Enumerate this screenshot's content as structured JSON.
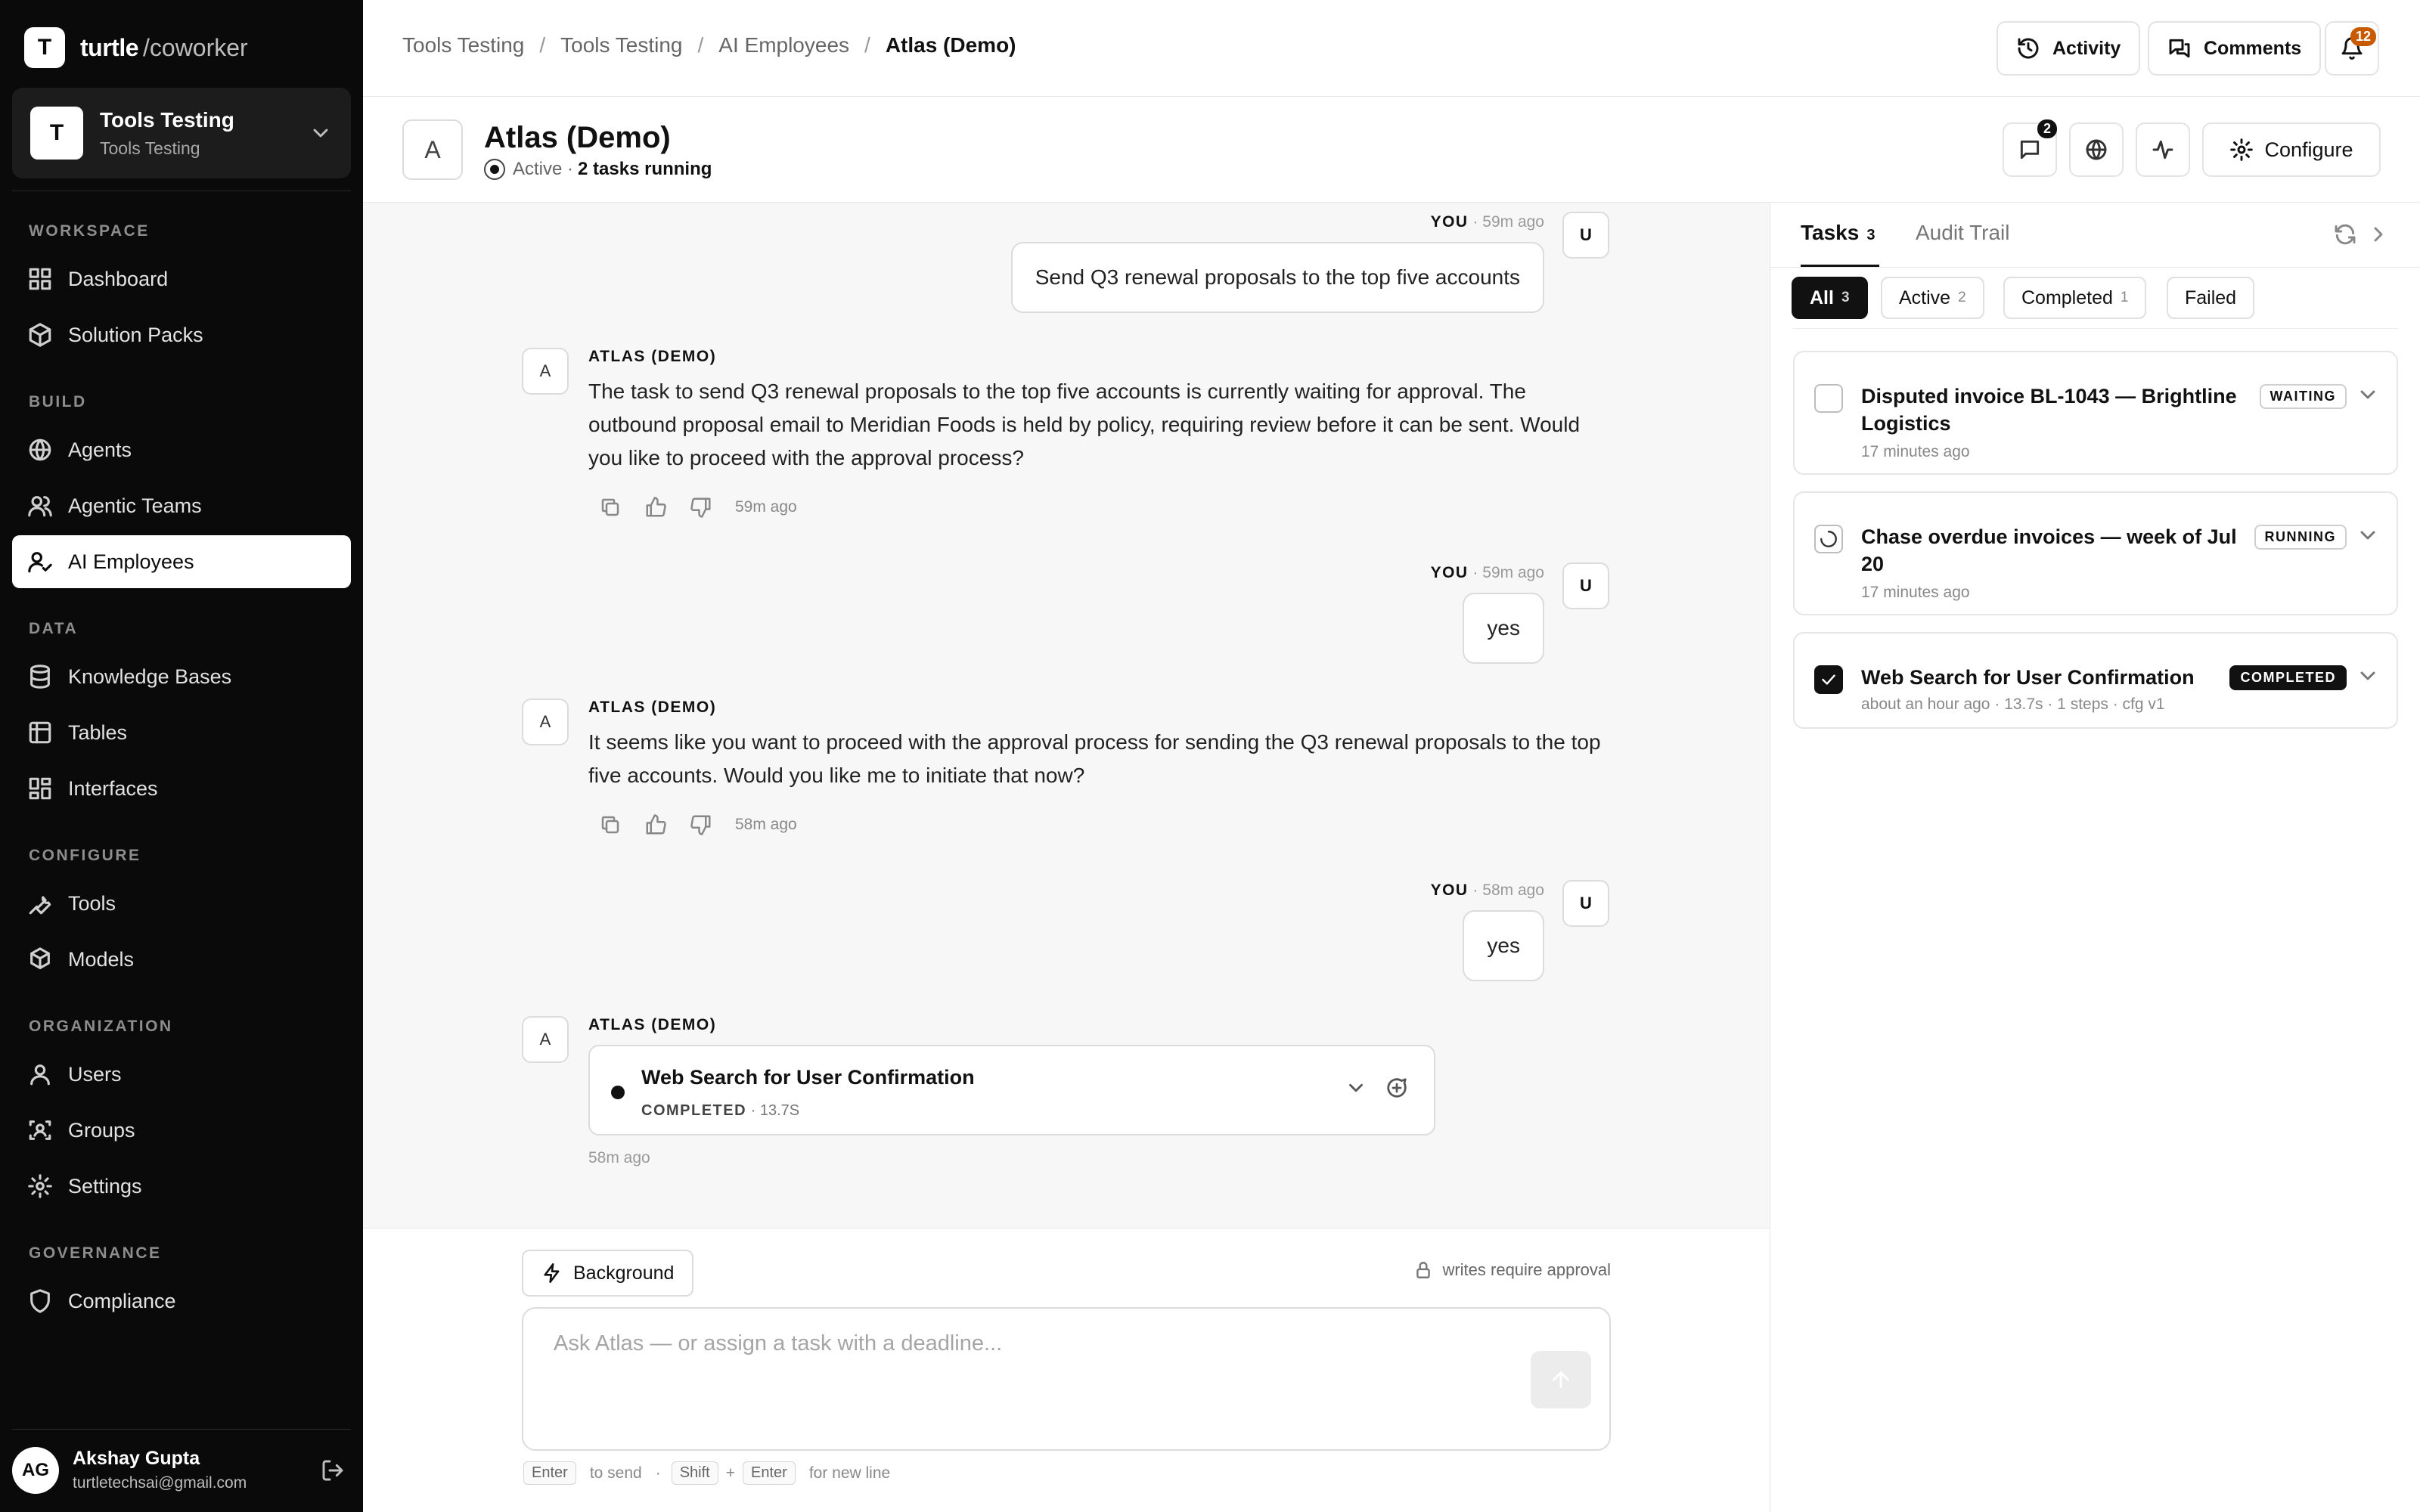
{
  "brand": {
    "logo_letter": "T",
    "name": "turtle",
    "suffix": "/coworker"
  },
  "workspace": {
    "avatar": "T",
    "title": "Tools Testing",
    "subtitle": "Tools Testing"
  },
  "sidebar": {
    "sections": [
      {
        "label": "WORKSPACE",
        "items": [
          {
            "label": "Dashboard",
            "icon": "grid-icon"
          },
          {
            "label": "Solution Packs",
            "icon": "package-icon"
          }
        ]
      },
      {
        "label": "BUILD",
        "items": [
          {
            "label": "Agents",
            "icon": "globe-icon"
          },
          {
            "label": "Agentic Teams",
            "icon": "users-icon"
          },
          {
            "label": "AI Employees",
            "icon": "user-check-icon",
            "active": true
          }
        ]
      },
      {
        "label": "DATA",
        "items": [
          {
            "label": "Knowledge Bases",
            "icon": "database-icon"
          },
          {
            "label": "Tables",
            "icon": "table-icon"
          },
          {
            "label": "Interfaces",
            "icon": "layout-icon"
          }
        ]
      },
      {
        "label": "CONFIGURE",
        "items": [
          {
            "label": "Tools",
            "icon": "wrench-icon"
          },
          {
            "label": "Models",
            "icon": "cube-icon"
          }
        ]
      },
      {
        "label": "ORGANIZATION",
        "items": [
          {
            "label": "Users",
            "icon": "user-icon"
          },
          {
            "label": "Groups",
            "icon": "group-icon"
          },
          {
            "label": "Settings",
            "icon": "gear-icon"
          }
        ]
      },
      {
        "label": "GOVERNANCE",
        "items": [
          {
            "label": "Compliance",
            "icon": "shield-icon"
          }
        ]
      }
    ]
  },
  "user": {
    "initials": "AG",
    "name": "Akshay Gupta",
    "email": "turtletechsai@gmail.com"
  },
  "breadcrumb": [
    "Tools Testing",
    "Tools Testing",
    "AI Employees",
    "Atlas (Demo)"
  ],
  "topbar": {
    "activity": "Activity",
    "comments": "Comments",
    "notifications": "12"
  },
  "agent": {
    "avatar": "A",
    "name": "Atlas (Demo)",
    "status": "Active",
    "tasks_running": "2 tasks running",
    "comment_count": "2",
    "configure": "Configure"
  },
  "chat": {
    "you_label": "YOU",
    "agent_label": "ATLAS (DEMO)",
    "user_avatar": "U",
    "agent_avatar": "A",
    "msg1": {
      "time": "59m ago",
      "text": "Send Q3 renewal proposals to the top five accounts"
    },
    "msg2": {
      "time": "59m ago",
      "text": "The task to send Q3 renewal proposals to the top five accounts is currently waiting for approval. The outbound proposal email to Meridian Foods is held by policy, requiring review before it can be sent. Would you like to proceed with the approval process?"
    },
    "msg3": {
      "time": "59m ago",
      "text": "yes"
    },
    "msg4": {
      "time": "58m ago",
      "text": "It seems like you want to proceed with the approval process for sending the Q3 renewal proposals to the top five accounts. Would you like me to initiate that now?"
    },
    "msg5": {
      "time": "58m ago",
      "text": "yes"
    },
    "msg6": {
      "time": "58m ago",
      "card_title": "Web Search for User Confirmation",
      "card_status": "COMPLETED",
      "card_duration": "13.7S"
    }
  },
  "composer": {
    "background": "Background",
    "approval_note": "writes require approval",
    "placeholder": "Ask Atlas — or assign a task with a deadline...",
    "hint_enter": "Enter",
    "hint_send": "to send",
    "hint_shift": "Shift",
    "hint_plus": "+",
    "hint_newline": "for new line",
    "hint_dot": "·"
  },
  "panel": {
    "tabs": {
      "tasks": "Tasks",
      "tasks_count": "3",
      "audit": "Audit Trail"
    },
    "filters": [
      {
        "label": "All",
        "count": "3",
        "active": true
      },
      {
        "label": "Active",
        "count": "2"
      },
      {
        "label": "Completed",
        "count": "1"
      },
      {
        "label": "Failed",
        "count": ""
      }
    ],
    "tasks": [
      {
        "title": "Disputed invoice BL-1043 — Brightline Logistics",
        "time": "17 minutes ago",
        "status": "WAITING"
      },
      {
        "title": "Chase overdue invoices — week of Jul 20",
        "time": "17 minutes ago",
        "status": "RUNNING"
      },
      {
        "title": "Web Search for User Confirmation",
        "time": "about an hour ago · 13.7s · 1 steps · cfg v1",
        "status": "COMPLETED"
      }
    ]
  }
}
